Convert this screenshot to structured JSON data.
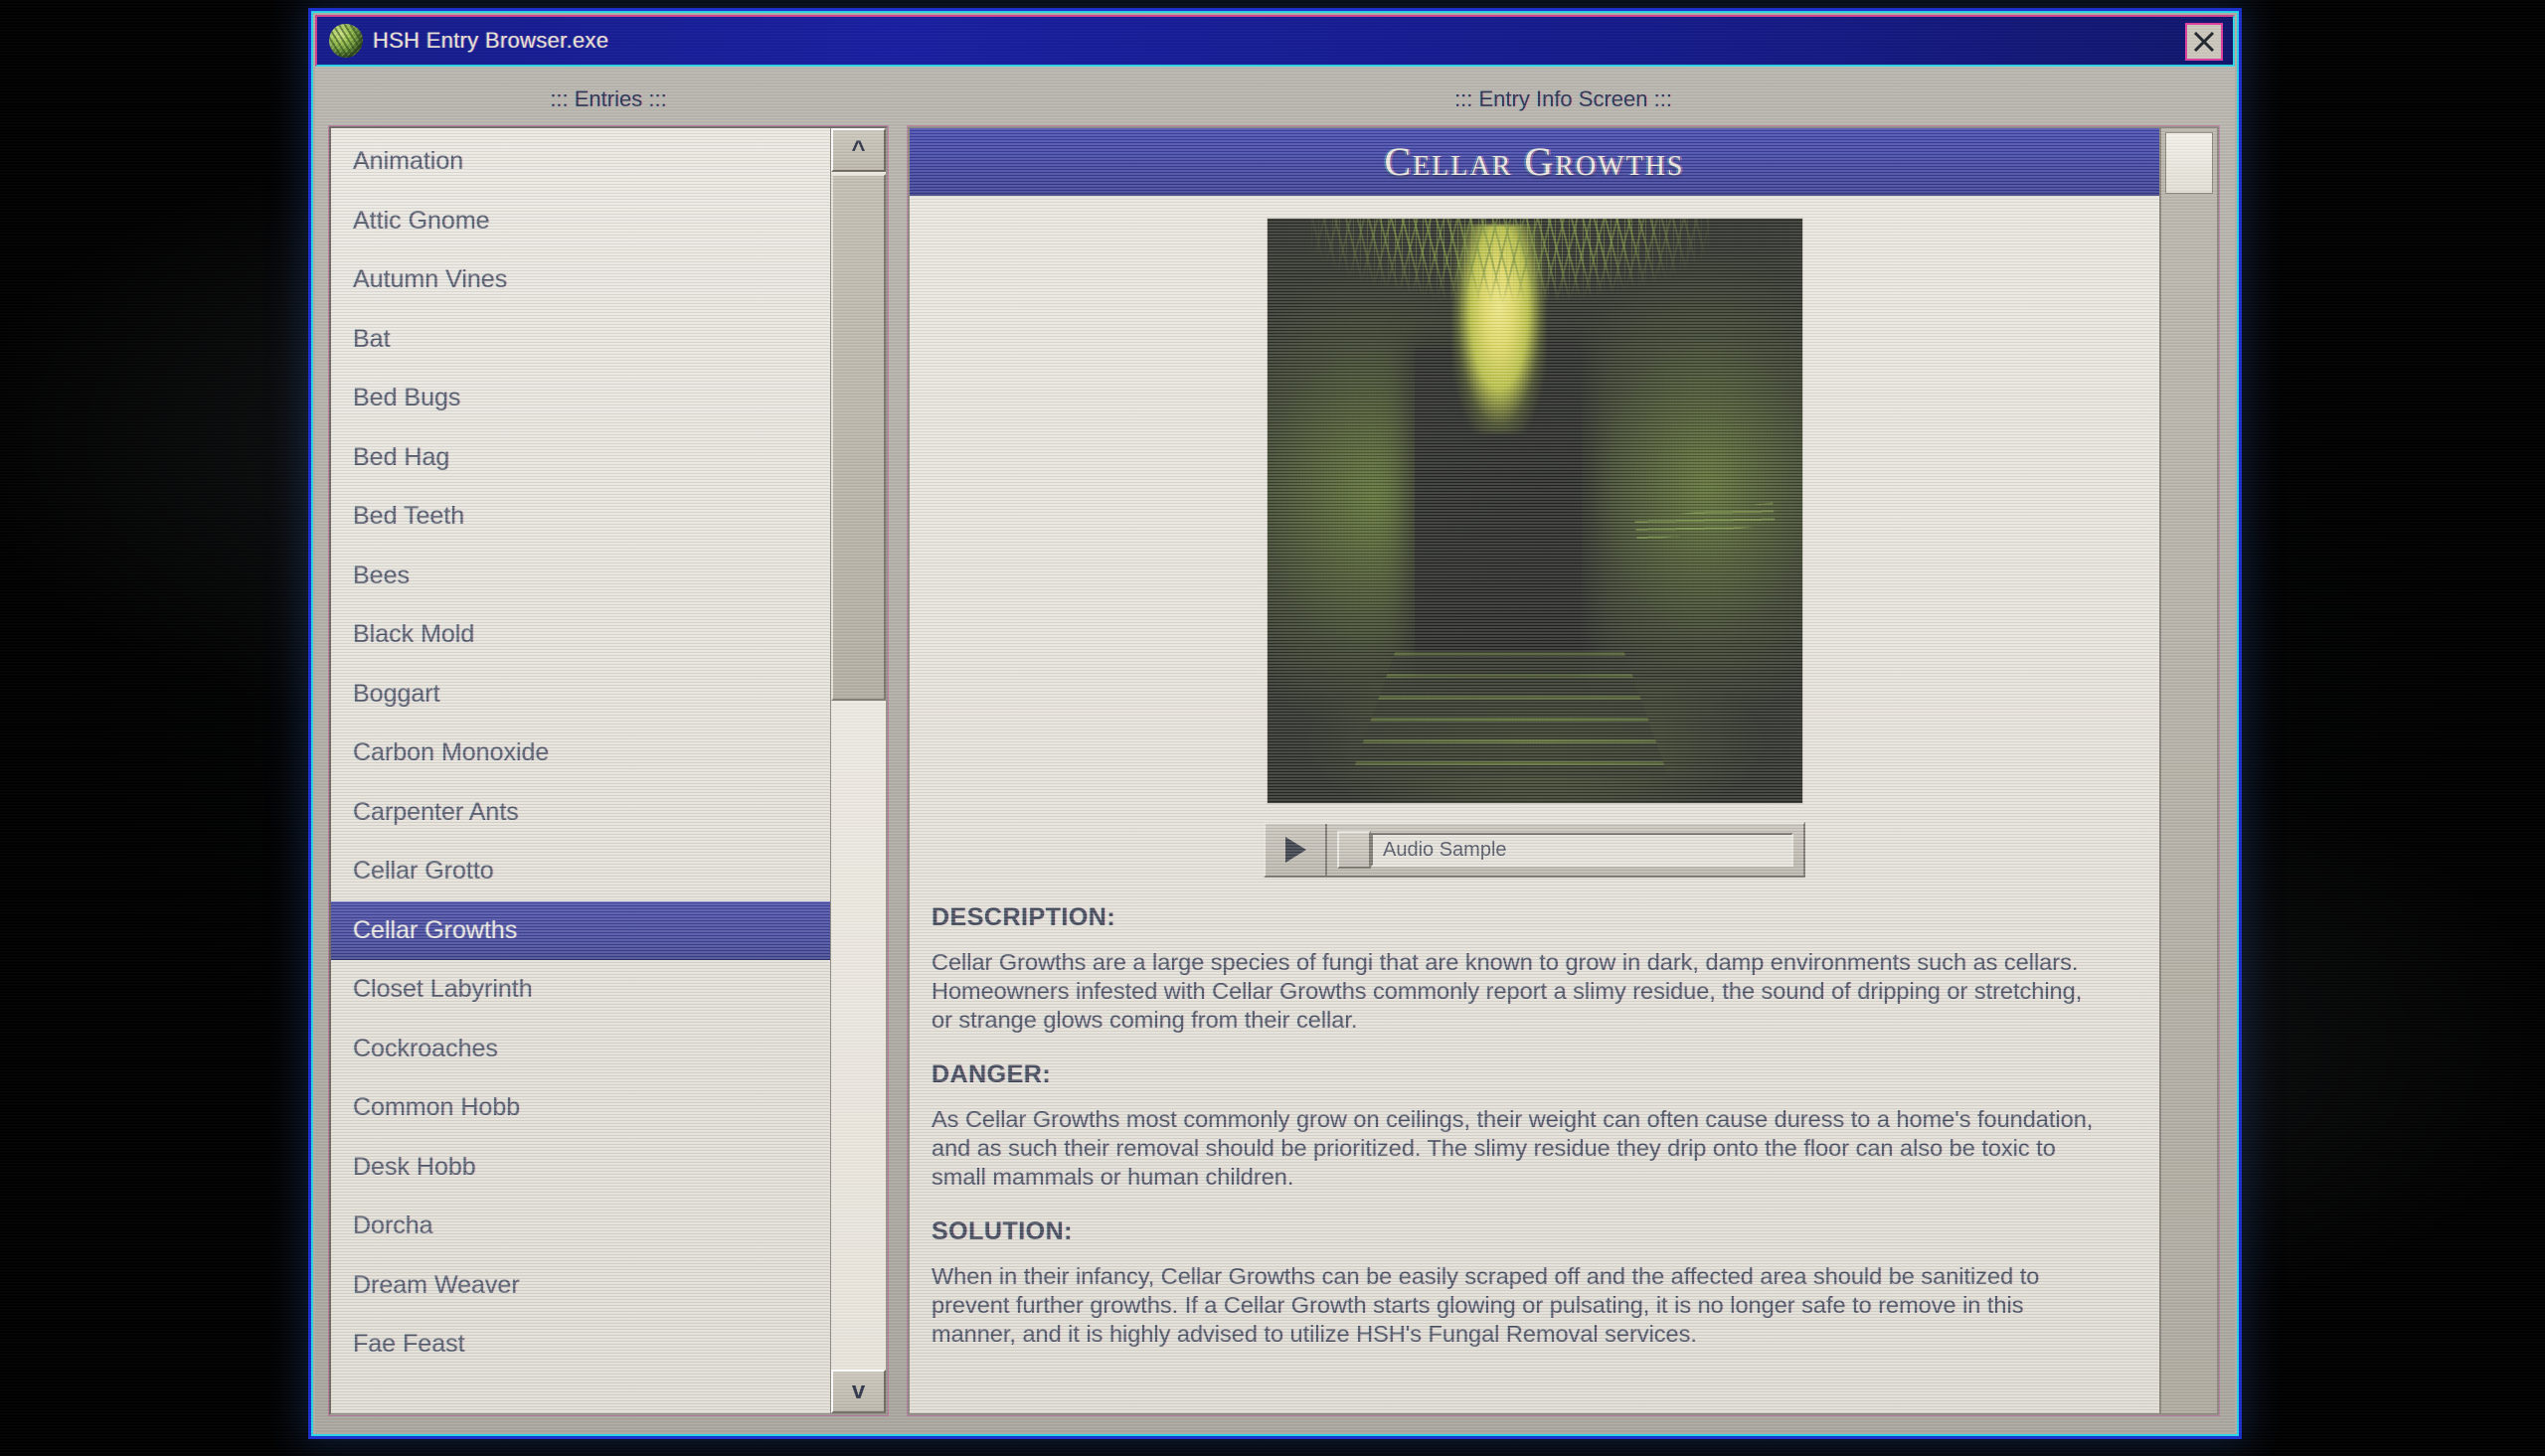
{
  "window": {
    "title": "HSH Entry Browser.exe",
    "icon": "mold-blob-icon",
    "close_label": "X",
    "accent_titlebar": "#1a1fa0",
    "accent_border": "#1b2fd0",
    "accent_selection": "#242a93"
  },
  "left_pane": {
    "caption": "::: Entries :::",
    "scroll_up_label": "^",
    "scroll_down_label": "v",
    "selected": "Cellar Growths",
    "entries": [
      "Animation",
      "Attic Gnome",
      "Autumn Vines",
      "Bat",
      "Bed Bugs",
      "Bed Hag",
      "Bed Teeth",
      "Bees",
      "Black Mold",
      "Boggart",
      "Carbon Monoxide",
      "Carpenter Ants",
      "Cellar Grotto",
      "Cellar Growths",
      "Closet Labyrinth",
      "Cockroaches",
      "Common Hobb",
      "Desk Hobb",
      "Dorcha",
      "Dream Weaver",
      "Fae Feast"
    ]
  },
  "right_pane": {
    "caption": "::: Entry Info Screen :::",
    "entry_title": "Cellar Growths",
    "illustration_alt": "glowing yellow-green fungal growth hanging from a dark cellar ceiling above stairs",
    "audio": {
      "play_label": "▶",
      "sample_label": "Audio Sample"
    },
    "sections": [
      {
        "heading": "DESCRIPTION:",
        "body": "Cellar Growths are a large species of fungi that are known to grow in dark, damp environments such as cellars. Homeowners infested with Cellar Growths commonly report a slimy residue, the sound of dripping or stretching, or strange glows coming from their cellar."
      },
      {
        "heading": "DANGER:",
        "body": "As Cellar Growths most commonly grow on ceilings, their weight can often cause duress to a home's foundation, and as such their removal should be prioritized. The slimy residue they drip onto the floor can also be toxic to small mammals or human children."
      },
      {
        "heading": "SOLUTION:",
        "body": "When in their infancy, Cellar Growths can be easily scraped off and the affected area should be sanitized to prevent further growths. If a Cellar Growth starts glowing or pulsating, it is no longer safe to remove in this manner, and it is highly advised to utilize HSH's Fungal Removal services."
      }
    ]
  }
}
